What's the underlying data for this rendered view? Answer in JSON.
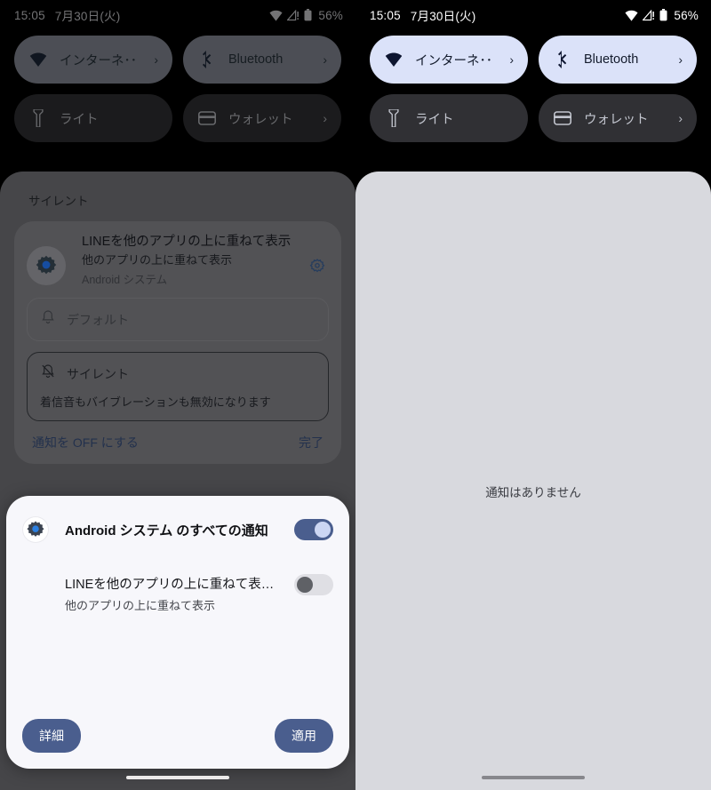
{
  "status_bar": {
    "time": "15:05",
    "date": "7月30日(火)",
    "battery_percent": "56%",
    "icons": [
      "wifi-icon",
      "cellular-signal-warning-icon",
      "battery-icon"
    ]
  },
  "quick_settings": {
    "tiles": [
      {
        "label": "インターネ･･",
        "icon": "wifi-icon",
        "state": "active",
        "chevron": "›"
      },
      {
        "label": "Bluetooth",
        "icon": "bluetooth-icon",
        "state": "active",
        "chevron": "›"
      },
      {
        "label": "ライト",
        "icon": "flashlight-icon",
        "state": "inactive",
        "chevron": ""
      },
      {
        "label": "ウォレット",
        "icon": "wallet-icon",
        "state": "inactive",
        "chevron": "›"
      }
    ]
  },
  "left_panel": {
    "shade_title": "サイレント",
    "notification": {
      "app_icon": "android-settings-gear-icon",
      "title": "LINEを他のアプリの上に重ねて表示",
      "subtitle": "他のアプリの上に重ねて表示",
      "app_name": "Android システム",
      "settings_icon": "gear-icon",
      "options": [
        {
          "label": "デフォルト",
          "icon": "bell-icon",
          "selected": false,
          "description": ""
        },
        {
          "label": "サイレント",
          "icon": "bell-off-icon",
          "selected": true,
          "description": "着信音もバイブレーションも無効になります"
        }
      ],
      "actions": {
        "turn_off": "通知を OFF にする",
        "done": "完了"
      }
    },
    "dialog": {
      "app_icon": "android-settings-gear-icon",
      "main_label": "Android システム のすべての通知",
      "main_toggle_state": "on",
      "sub_title": "LINEを他のアプリの上に重ねて表…",
      "sub_desc": "他のアプリの上に重ねて表示",
      "sub_toggle_state": "off",
      "details_button": "詳細",
      "apply_button": "適用"
    }
  },
  "right_panel": {
    "empty_message": "通知はありません"
  },
  "colors": {
    "accent_blue": "#4a5e8e",
    "tile_active_bright": "#dbe2f9",
    "tile_active_dim": "#5d6068",
    "shade_dim": "#565659",
    "shade_bright": "#d8d9de",
    "dialog_bg": "#f7f7fb"
  }
}
